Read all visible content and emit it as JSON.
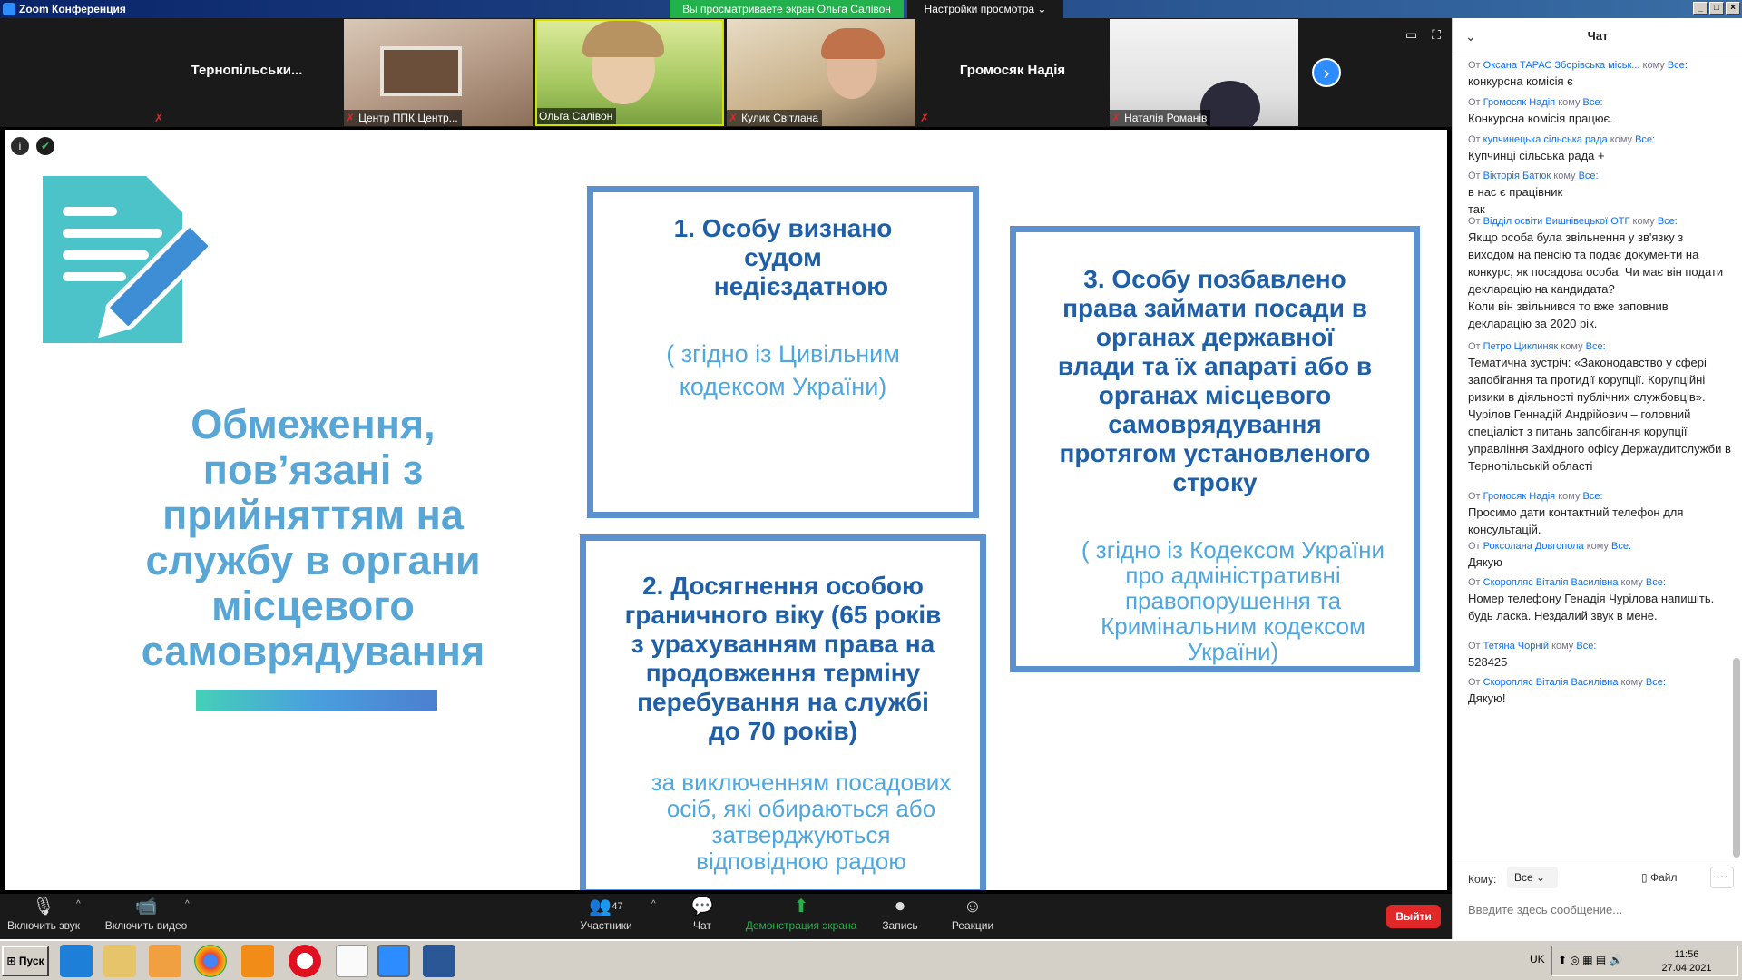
{
  "window": {
    "title": "Zoom Конференция",
    "share_banner": "Вы просматриваете экран Ольга Салівон",
    "view_options": "Настройки просмотра ⌄"
  },
  "participants": [
    {
      "name": "Тернопільськи...",
      "type": "name-only"
    },
    {
      "name": "Центр ППК Центр...",
      "type": "video"
    },
    {
      "name": "Ольга Салівон",
      "type": "video"
    },
    {
      "name": "Кулик Світлана",
      "type": "video"
    },
    {
      "name": "Громосяк Надія",
      "type": "name-only"
    },
    {
      "name": "Наталія Романів",
      "type": "video"
    }
  ],
  "slide": {
    "title": "Обмеження, пов’язані з прийняттям на службу в органи місцевого самоврядування",
    "box1": {
      "heading_line1": "1.  Особу визнано",
      "heading_line2": "судом",
      "heading_line3": "недієздатною",
      "note_line1": "( згідно із Цивільним",
      "note_line2": "кодексом України)"
    },
    "box2": {
      "heading_lines": [
        "2. Досягнення особою",
        "граничного віку (65 років",
        "з урахуванням  права на",
        "продовження терміну",
        "перебування на службі",
        "до 70 років)"
      ],
      "note_lines": [
        "за виключенням посадових",
        "осіб, які обираються або",
        "затверджуються",
        "відповідною радою"
      ]
    },
    "box3": {
      "heading_lines": [
        "3. Особу позбавлено",
        "права займати посади в",
        "органах державної",
        "влади та їх апараті або в",
        "органах місцевого",
        "самоврядування",
        "протягом установленого",
        "строку"
      ],
      "note_lines": [
        "( згідно із Кодексом України",
        "про  адміністративні",
        "правопорушення та",
        "Кримінальним кодексом",
        "України)"
      ]
    }
  },
  "chat": {
    "title": "Чат",
    "messages": [
      {
        "from_word": "От",
        "sender": "Оксана ТАРАС Зборівська міськ...",
        "to_word": "кому",
        "to": "Все:",
        "text": "конкурсна комісія є"
      },
      {
        "from_word": "От",
        "sender": "Громосяк Надія",
        "to_word": "кому",
        "to": "Все:",
        "text": "Конкурсна комісія працює."
      },
      {
        "from_word": "От",
        "sender": "купчинецька сільська рада",
        "to_word": "кому",
        "to": "Все:",
        "text": "Купчинці сільська рада +"
      },
      {
        "from_word": "От",
        "sender": "Вікторія Батюк",
        "to_word": "кому",
        "to": "Все:",
        "text": "в нас є працівник\nтак"
      },
      {
        "from_word": "От",
        "sender": "Відділ  освіти Вишнівецької ОТГ",
        "to_word": "кому",
        "to": "Все:",
        "text": "Якщо особа була звільнення у зв'язку з виходом на пенсію та подає документи на конкурс, як посадова особа. Чи має він подати декларацію на   кандидата?\nКоли він звільнився то вже заповнив декларацію за 2020 рік."
      },
      {
        "from_word": "От",
        "sender": "Петро Циклиняк",
        "to_word": "кому",
        "to": "Все:",
        "text": "Тематична зустріч: «Законодавство у сфері запобігання та протидії корупції. Корупційні ризики в діяльності публічних службовців».   Чурілов Геннадій Андрійович – головний спеціаліст з питань запобігання корупції управління Західного офісу Держаудитслужби в Тернопільській області"
      },
      {
        "from_word": "От",
        "sender": "Громосяк Надія",
        "to_word": "кому",
        "to": "Все:",
        "text": "Просимо дати контактний телефон для консультацій."
      },
      {
        "from_word": "От",
        "sender": "Роксолана Довгопола",
        "to_word": "кому",
        "to": "Все:",
        "text": "Дякую"
      },
      {
        "from_word": "От",
        "sender": "Скоропляс Віталія Василівна",
        "to_word": "кому",
        "to": "Все:",
        "text": "Номер телефону Генадія Чурілова напишіть. будь ласка. Нездалий звук в мене."
      },
      {
        "from_word": "От",
        "sender": "Тетяна Чорній",
        "to_word": "кому",
        "to": "Все:",
        "text": "528425"
      },
      {
        "from_word": "От",
        "sender": "Скоропляс Віталія Василівна",
        "to_word": "кому",
        "to": "Все:",
        "text": "Дякую!"
      }
    ],
    "to_label": "Кому:",
    "to_value": "Все",
    "file_label": "Файл",
    "more_label": "···",
    "input_placeholder": "Введите здесь сообщение..."
  },
  "toolbar": {
    "mute_label": "Включить звук",
    "video_label": "Включить видео",
    "participants_label": "Участники",
    "participants_count": "47",
    "chat_label": "Чат",
    "share_label": "Демонстрация экрана",
    "record_label": "Запись",
    "reactions_label": "Реакции",
    "leave_label": "Выйти"
  },
  "taskbar": {
    "start_label": "Пуск",
    "language": "UK",
    "time": "11:56",
    "date": "27.04.2021"
  }
}
